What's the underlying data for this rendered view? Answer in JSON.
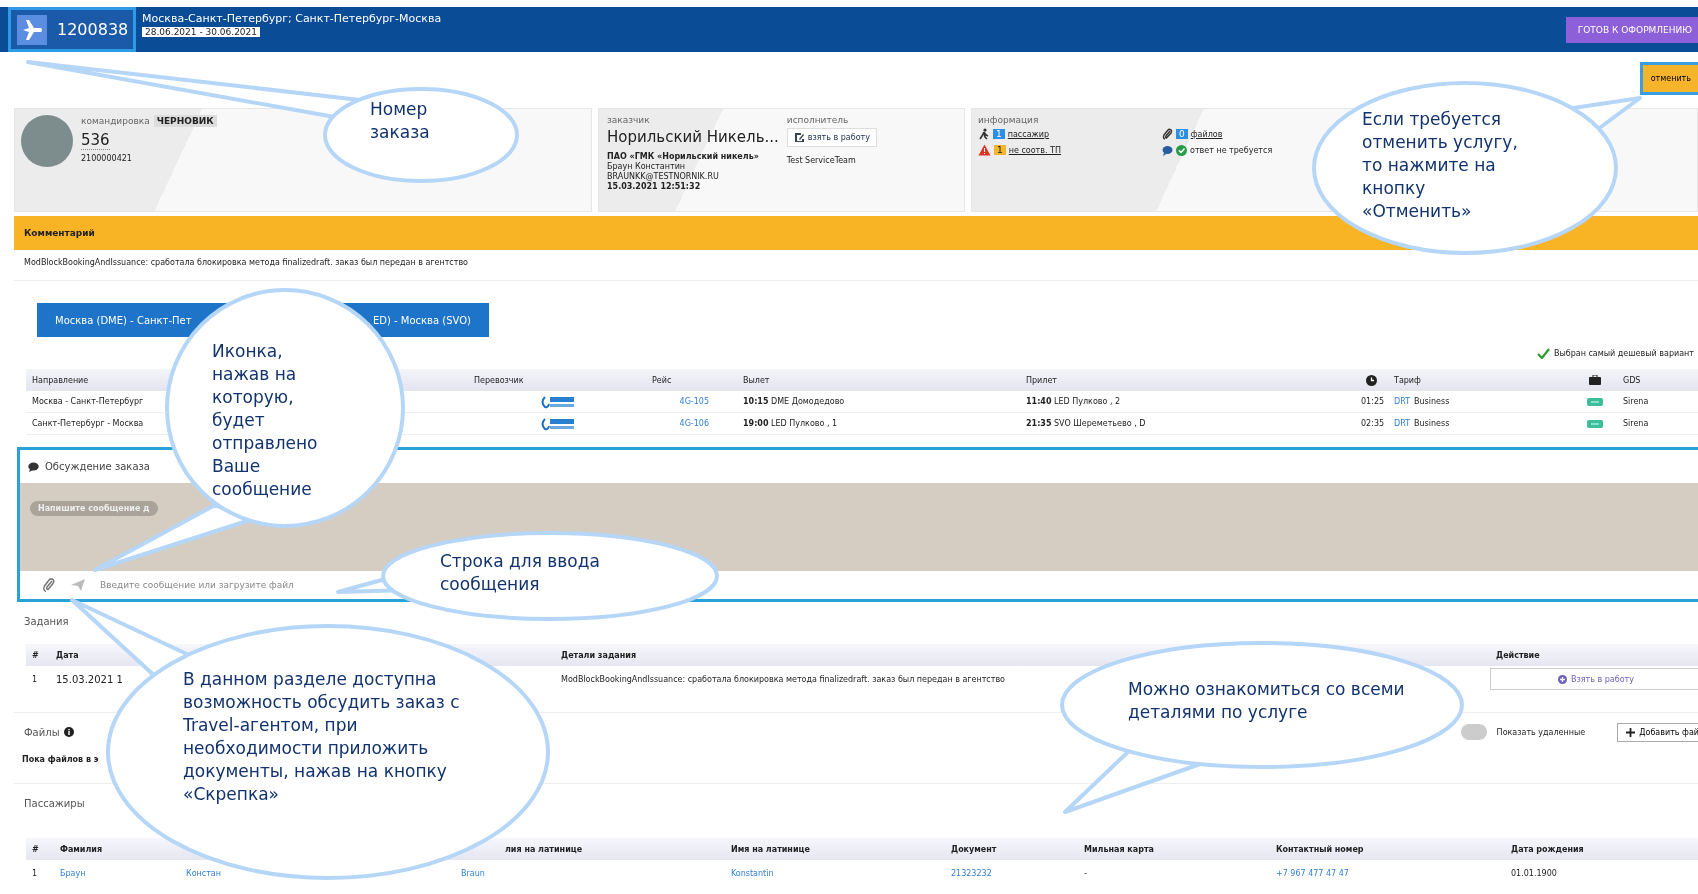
{
  "header": {
    "order_number": "1200838",
    "route": "Москва-Санкт-Петербург; Санкт-Петербург-Москва",
    "dates": "28.06.2021 - 30.06.2021",
    "status_button": "ГОТОВ К ОФОРМЛЕНИЮ"
  },
  "cancel_button": "отменить",
  "trip_card": {
    "type": "командировка",
    "status": "ЧЕРНОВИК",
    "number": "536",
    "code": "2100000421"
  },
  "customer_card": {
    "label": "заказчик",
    "company": "Норильский Никель...",
    "org": "ПАО «ГМК «Норильский никель»",
    "person": "Браун Константин",
    "email": "BRAUNKK@TESTNORNIK.RU",
    "datetime": "15.03.2021 12:51:32",
    "executor_label": "исполнитель",
    "take_button": "взять в работу",
    "executor": "Test ServiceTeam"
  },
  "info_card": {
    "label": "информация",
    "items": [
      {
        "kind": "passenger",
        "count": "1",
        "text": "пассажир"
      },
      {
        "kind": "warning",
        "count": "1",
        "text": "не соотв. ТП"
      },
      {
        "kind": "files",
        "count": "0",
        "text": "файлов"
      },
      {
        "kind": "reply",
        "text": "ответ не требуется"
      }
    ]
  },
  "comment": {
    "title": "Комментарий",
    "text": "ModBlockBookingAndIssuance: сработала блокировка метода finalizedraft. заказ был передан в агентство"
  },
  "route_tab": {
    "label_start": "Москва (DME) - Санкт-Пет",
    "label_end": "ED) - Москва (SVO)",
    "selected": true
  },
  "cheapest_note": "Выбран самый дешевый вариант",
  "flights": {
    "columns": [
      "Направление",
      "Перевозчик",
      "Рейс",
      "Вылет",
      "Прилет",
      "Тариф",
      "GDS"
    ],
    "rows": [
      {
        "direction": "Москва - Санкт-Петербург",
        "flight": "4G-105",
        "departure": "**10:15** DME Домодедово",
        "arrival": "**11:40** LED Пулково , 2",
        "duration": "01:25",
        "fare_code": "DRT",
        "fare": "Business",
        "gds": "Sirena"
      },
      {
        "direction": "Санкт-Петербург - Москва",
        "flight": "4G-106",
        "departure": "**19:00** LED Пулково , 1",
        "arrival": "**21:35** SVO Шереметьево , D",
        "duration": "02:35",
        "fare_code": "DRT",
        "fare": "Business",
        "gds": "Sirena"
      }
    ]
  },
  "discussion": {
    "title": "Обсуждение заказа",
    "pill": "Напишите сообщение д",
    "placeholder": "Введите сообщение или загрузите файл"
  },
  "tasks": {
    "title": "Задания",
    "columns": [
      "#",
      "Дата",
      "Детали задания",
      "Действие"
    ],
    "rows": [
      {
        "index": "1",
        "date": "15.03.2021 1",
        "details": "ModBlockBookingAndIssuance: сработала блокировка метода finalizedraft. заказ был передан в агентство",
        "action": "Взять в работу"
      }
    ]
  },
  "files": {
    "title": "Файлы",
    "show_deleted": {
      "label": "Показать удаленные",
      "on": false
    },
    "add_button": "Добавить фай",
    "empty": "Пока файлов в э"
  },
  "passengers": {
    "title": "Пассажиры",
    "columns": [
      "#",
      "Фамилия",
      "лия на латинице",
      "Имя на латинице",
      "Документ",
      "Мильная карта",
      "Контактный номер",
      "Дата рождения"
    ],
    "rows": [
      {
        "index": "1",
        "surname": "Браун",
        "name": "Констан",
        "surname_latin": "Braun",
        "name_latin": "Konstantin",
        "document": "21323232",
        "miles": "-",
        "phone": "+7 967 477 47 47",
        "birth": "01.01.1900"
      }
    ]
  },
  "callouts": [
    {
      "text": "Номер заказа"
    },
    {
      "text": "Если требуется отменить услугу, то нажмите на кнопку «Отменить»"
    },
    {
      "text": "Иконка, нажав на которую, будет отправлено Ваше сообщение"
    },
    {
      "text": "Строка для ввода сообщения"
    },
    {
      "text": "В данном разделе доступна возможность обсудить заказ с Travel-агентом, при необходимости приложить документы, нажав на кнопку «Скрепка»"
    },
    {
      "text": "Можно ознакомиться со всеми деталями по услуге"
    }
  ]
}
